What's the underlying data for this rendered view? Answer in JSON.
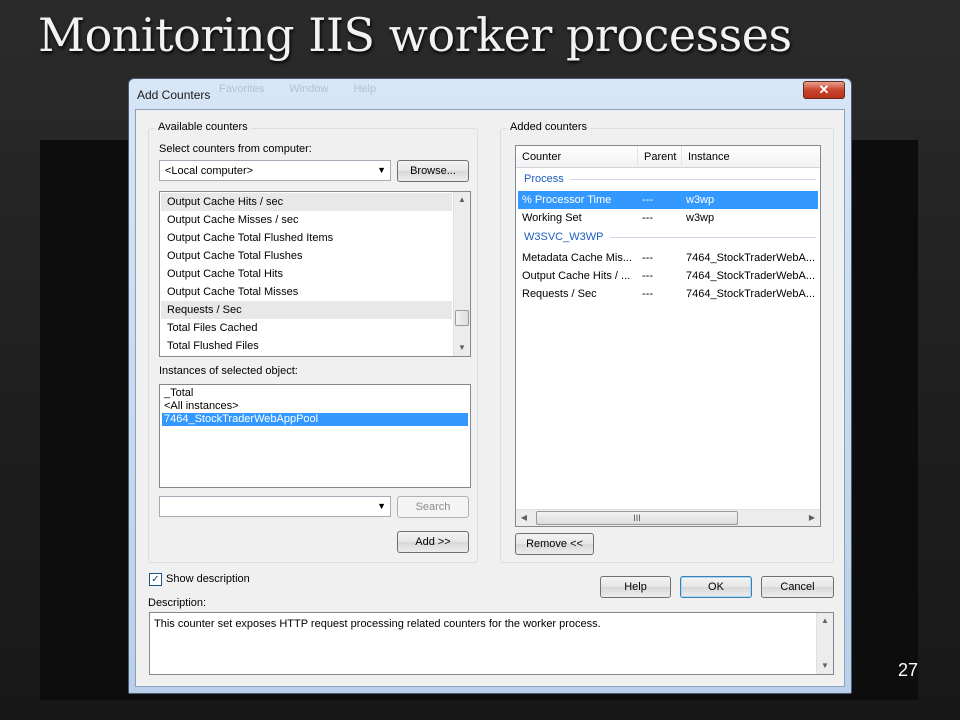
{
  "slide": {
    "title": "Monitoring IIS worker processes",
    "page_number": "27"
  },
  "window": {
    "title": "Add Counters",
    "close_glyph": "✕",
    "ghost_menu": "Favorites Window Help"
  },
  "available": {
    "group_label": "Available counters",
    "select_label": "Select counters from computer:",
    "computer_value": "<Local computer>",
    "browse_label": "Browse...",
    "counters": [
      {
        "label": "Output Cache Hits / sec",
        "header": true
      },
      {
        "label": "Output Cache Misses / sec",
        "header": false
      },
      {
        "label": "Output Cache Total Flushed Items",
        "header": false
      },
      {
        "label": "Output Cache Total Flushes",
        "header": false
      },
      {
        "label": "Output Cache Total Hits",
        "header": false
      },
      {
        "label": "Output Cache Total Misses",
        "header": false
      },
      {
        "label": "Requests / Sec",
        "header": true
      },
      {
        "label": "Total Files Cached",
        "header": false
      },
      {
        "label": "Total Flushed Files",
        "header": false
      }
    ],
    "instances_label": "Instances of selected object:",
    "instances": [
      "_Total",
      "<All instances>",
      "7464_StockTraderWebAppPool"
    ],
    "selected_instance": 2,
    "search_value": "",
    "search_label": "Search",
    "add_label": "Add >>"
  },
  "added": {
    "group_label": "Added counters",
    "columns": [
      "Counter",
      "Parent",
      "Instance"
    ],
    "groups": [
      {
        "name": "Process",
        "rows": [
          {
            "counter": "% Processor Time",
            "parent": "---",
            "instance": "w3wp",
            "selected": true
          },
          {
            "counter": "Working Set",
            "parent": "---",
            "instance": "w3wp",
            "selected": false
          }
        ]
      },
      {
        "name": "W3SVC_W3WP",
        "rows": [
          {
            "counter": "Metadata Cache Mis...",
            "parent": "---",
            "instance": "7464_StockTraderWebA...",
            "selected": false
          },
          {
            "counter": "Output Cache Hits / ...",
            "parent": "---",
            "instance": "7464_StockTraderWebA...",
            "selected": false
          },
          {
            "counter": "Requests / Sec",
            "parent": "---",
            "instance": "7464_StockTraderWebA...",
            "selected": false
          }
        ]
      }
    ],
    "scroll_grip": "III",
    "remove_label": "Remove <<"
  },
  "footer": {
    "show_description_label": "Show description",
    "show_description_checked": true,
    "help_label": "Help",
    "ok_label": "OK",
    "cancel_label": "Cancel",
    "description_label": "Description:",
    "description_text": "This counter set exposes HTTP request processing related counters for the worker process."
  },
  "colors": {
    "selection": "#3399ff",
    "group_header_text": "#1e5ebc"
  }
}
